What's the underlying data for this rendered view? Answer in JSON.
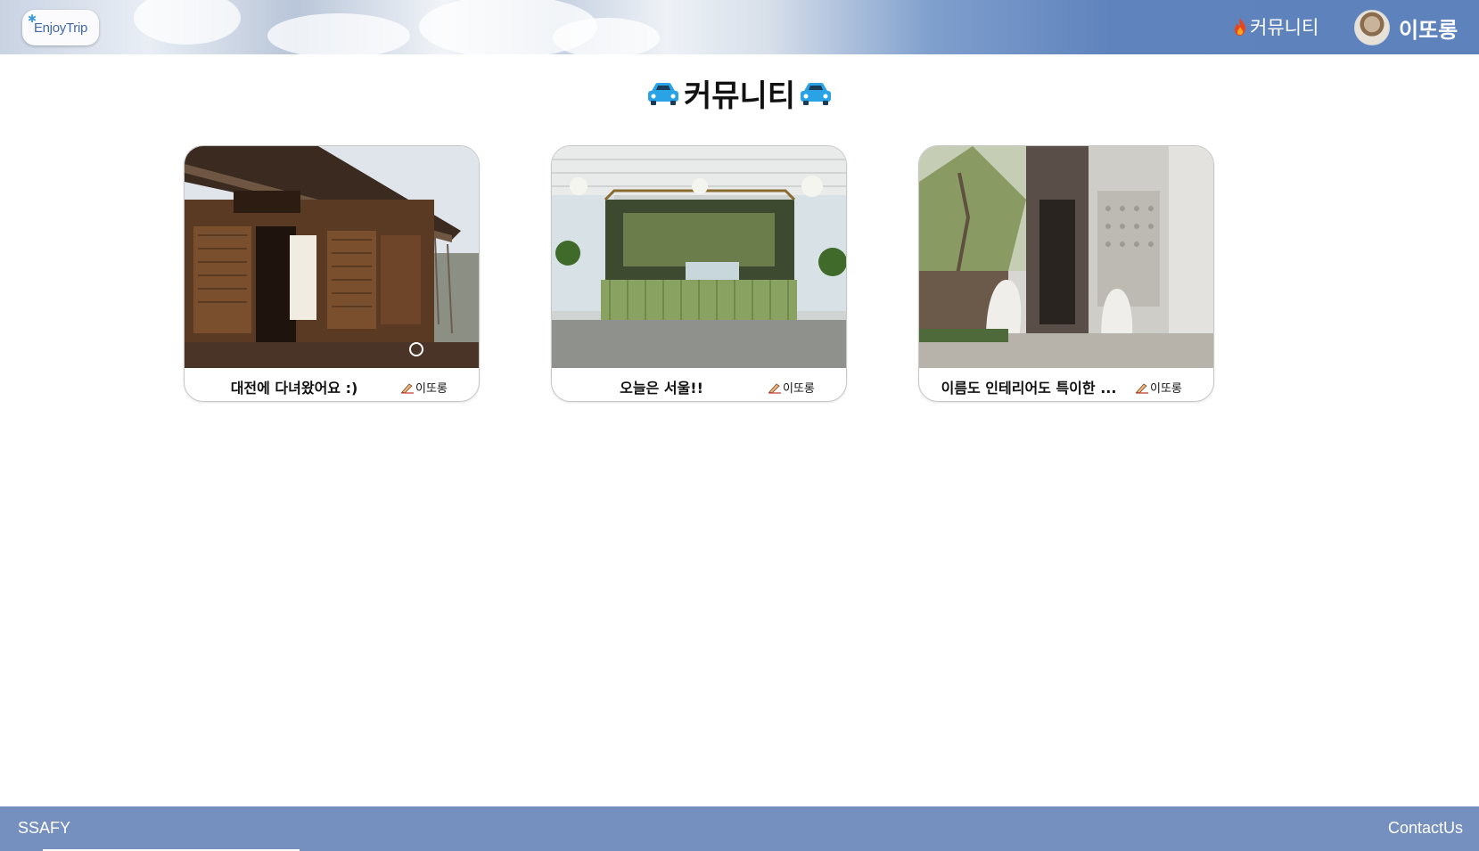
{
  "header": {
    "logo_text": "EnjoyTrip",
    "nav_community_label": "커뮤니티",
    "user_name": "이또롱"
  },
  "page": {
    "title": "커뮤니티"
  },
  "cards": [
    {
      "title": "대전에 다녀왔어요 :)",
      "author": "이또롱",
      "image": "hanok-house-photo"
    },
    {
      "title": "오늘은 서울!!",
      "author": "이또롱",
      "image": "cafe-interior-photo"
    },
    {
      "title": "이름도 인테리어도 특이한 ...",
      "author": "이또롱",
      "image": "building-with-lion-statues-photo"
    }
  ],
  "footer": {
    "left_label": "SSAFY",
    "right_label": "ContactUs"
  },
  "colors": {
    "header_blue": "#5e82bc",
    "footer_blue": "#7590bf",
    "car_blue": "#29a3e6"
  }
}
